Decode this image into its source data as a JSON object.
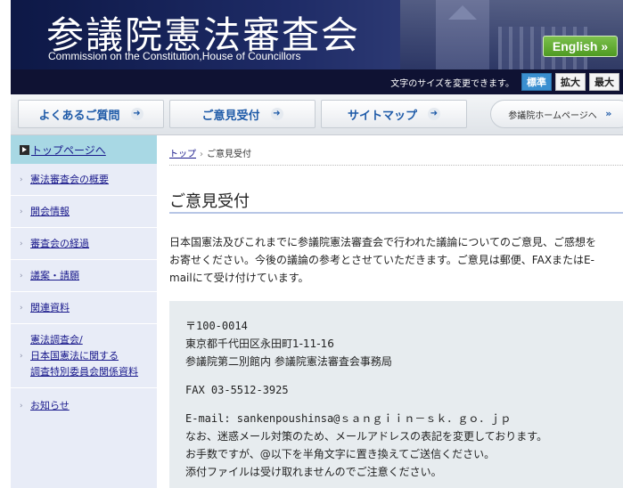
{
  "header": {
    "title": "参議院憲法審査会",
    "subtitle": "Commission on the Constitution,House of Councillors",
    "english_label": "English »"
  },
  "fontbar": {
    "label": "文字のサイズを変更できます。",
    "sizes": [
      "標準",
      "拡大",
      "最大"
    ],
    "active_size": "標準"
  },
  "nav": {
    "items": [
      {
        "label": "よくあるご質問",
        "arrow": "➜"
      },
      {
        "label": "ご意見受付",
        "arrow": "➜"
      },
      {
        "label": "サイトマップ",
        "arrow": "➜"
      }
    ],
    "home_label": "参議院ホームページへ",
    "home_arrow": "»"
  },
  "sidebar": {
    "top_label": "トップページへ",
    "items": [
      {
        "label": "憲法審査会の概要"
      },
      {
        "label": "開会情報"
      },
      {
        "label": "審査会の経過"
      },
      {
        "label": "議案・請願"
      },
      {
        "label": "関連資料"
      },
      {
        "lines": [
          "憲法調査会/",
          "日本国憲法に関する",
          "調査特別委員会関係資料"
        ]
      },
      {
        "label": "お知らせ"
      }
    ],
    "chevron": "›"
  },
  "breadcrumb": {
    "home": "トップ",
    "separator": "›",
    "current": "ご意見受付"
  },
  "main": {
    "title": "ご意見受付",
    "intro": [
      "日本国憲法及びこれまでに参議院憲法審査会で行われた議論についてのご意見、ご感想を",
      "お寄せください。今後の議論の参考とさせていただきます。ご意見は郵便、FAXまたはE-",
      "mailにて受け付けています。"
    ],
    "postal": "〒100-0014",
    "address1": "東京都千代田区永田町1-11-16",
    "address2": "参議院第二別館内 参議院憲法審査会事務局",
    "fax": "FAX 03-5512-3925",
    "email": "E-mail: sankenpoushinsa@ｓａｎｇｉｉｎ－ｓｋ．ｇｏ．ｊｐ",
    "notes": [
      "なお、迷惑メール対策のため、メールアドレスの表記を変更しております。",
      "お手数ですが、@以下を半角文字に置き換えてご送信ください。",
      "添付ファイルは受け取れませんのでご注意ください。"
    ]
  }
}
